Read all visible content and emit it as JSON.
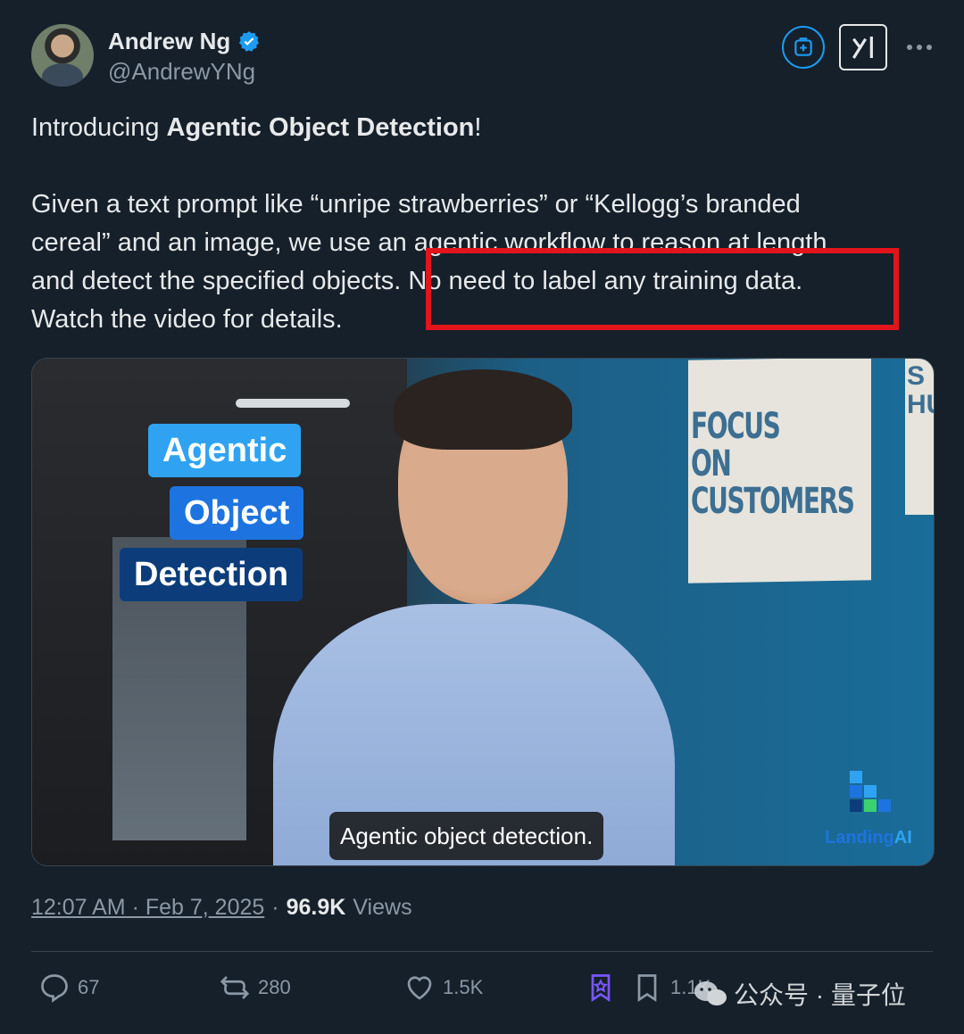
{
  "author": {
    "name": "Andrew Ng",
    "handle": "@AndrewYNg",
    "verified": true
  },
  "tweet": {
    "line1_prefix": "Introducing ",
    "line1_bold": "Agentic Object Detection",
    "line1_suffix": "!",
    "para2_line1": "Given a text prompt like “unripe strawberries” or “Kellogg’s branded",
    "para2_line2": "cereal” and an image, we use an agentic workflow to reason at length",
    "para2_line3": "and detect the specified objects. No need to label any training data.",
    "para2_line4": "Watch the video for details."
  },
  "video": {
    "tag_agentic": "Agentic",
    "tag_object": "Object",
    "tag_detection": "Detection",
    "caption": "Agentic object detection.",
    "poster_line1": "FOCUS ON",
    "poster_line2": "CUSTOMERS",
    "poster2_text": "S HU",
    "brand_part1": "Landing",
    "brand_part2": "AI"
  },
  "meta": {
    "time": "12:07 AM · Feb 7, 2025",
    "separator": "·",
    "views_count": "96.9K",
    "views_label": "Views"
  },
  "actions": {
    "replies": "67",
    "reposts": "280",
    "likes": "1.5K",
    "bookmarks": "1.1K"
  },
  "watermark": {
    "text": "公众号 · 量子位"
  },
  "colors": {
    "background": "#15202b",
    "accent": "#1d9bf0",
    "highlight_box": "#e3141b"
  }
}
